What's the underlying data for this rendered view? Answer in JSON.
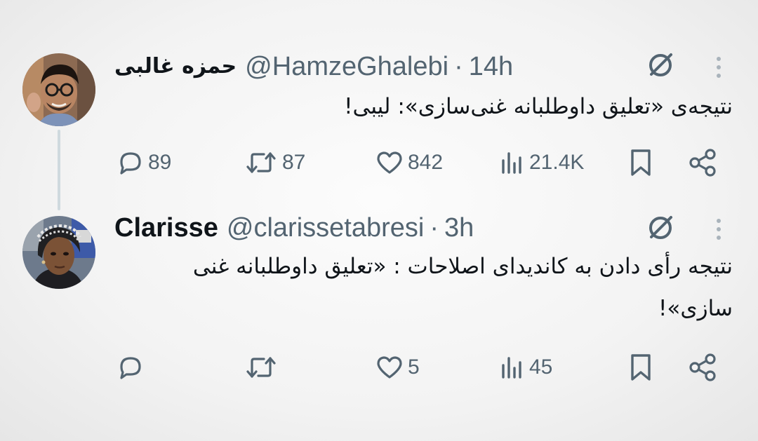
{
  "tweets": [
    {
      "display_name": "حمزه غالبی",
      "handle": "@HamzeGhalebi",
      "separator": "·",
      "time": "14h",
      "text": "نتیجه‌ی «تعلیق داوطلبانه غنی‌سازی»: لیبی!",
      "replies": "89",
      "reposts": "87",
      "likes": "842",
      "views": "21.4K"
    },
    {
      "display_name": "Clarisse",
      "handle": "@clarissetabresi",
      "separator": "·",
      "time": "3h",
      "text": "نتیجه رأی دادن به کاندیدای اصلاحات :  «تعلیق داوطلبانه غنی سازی»!",
      "replies": "",
      "reposts": "",
      "likes": "5",
      "views": "45"
    }
  ],
  "icons": {
    "reply": "speech-bubble",
    "repost": "repost-arrows",
    "like": "heart",
    "views": "bar-chart",
    "bookmark": "bookmark",
    "share": "share-nodes",
    "grok": "grok-slash-circle",
    "more": "vertical-ellipsis"
  },
  "colors": {
    "text_primary": "#0f1419",
    "text_secondary": "#536471",
    "thread_line": "#cfd9de"
  }
}
